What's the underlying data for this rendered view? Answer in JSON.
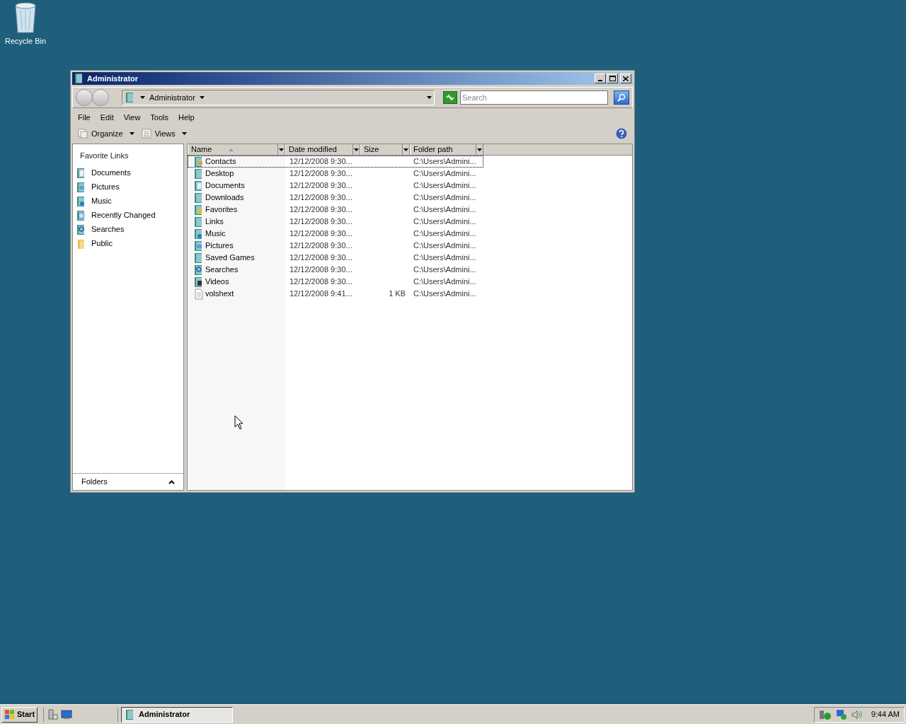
{
  "desktop_icons": [
    {
      "label": "Recycle Bin"
    }
  ],
  "window": {
    "title": "Administrator",
    "active": true
  },
  "address_bar": {
    "path": "Administrator"
  },
  "search": {
    "placeholder": "Search"
  },
  "menu_bar": [
    "File",
    "Edit",
    "View",
    "Tools",
    "Help"
  ],
  "toolbar": [
    {
      "label": "Organize",
      "kind": "organize"
    },
    {
      "label": "Views",
      "kind": "views"
    }
  ],
  "sidebar": {
    "title": "Favorite Links",
    "items": [
      {
        "label": "Documents",
        "kind": "documents"
      },
      {
        "label": "Pictures",
        "kind": "pictures"
      },
      {
        "label": "Music",
        "kind": "music"
      },
      {
        "label": "Recently Changed",
        "kind": "recent"
      },
      {
        "label": "Searches",
        "kind": "searches"
      },
      {
        "label": "Public",
        "kind": "public"
      }
    ],
    "folders_label": "Folders"
  },
  "table": {
    "columns": [
      {
        "label": "Name",
        "sorted": true
      },
      {
        "label": "Date modified",
        "sorted": false
      },
      {
        "label": "Size",
        "sorted": false
      },
      {
        "label": "Folder path",
        "sorted": false
      }
    ],
    "rows": [
      {
        "name": "Contacts",
        "kind": "contacts",
        "date": "12/12/2008 9:30...",
        "size": "",
        "path": "C:\\Users\\Admini...",
        "focused": true
      },
      {
        "name": "Desktop",
        "kind": "folder",
        "date": "12/12/2008 9:30...",
        "size": "",
        "path": "C:\\Users\\Admini...",
        "focused": false
      },
      {
        "name": "Documents",
        "kind": "documents",
        "date": "12/12/2008 9:30...",
        "size": "",
        "path": "C:\\Users\\Admini...",
        "focused": false
      },
      {
        "name": "Downloads",
        "kind": "folder",
        "date": "12/12/2008 9:30...",
        "size": "",
        "path": "C:\\Users\\Admini...",
        "focused": false
      },
      {
        "name": "Favorites",
        "kind": "favorites",
        "date": "12/12/2008 9:30...",
        "size": "",
        "path": "C:\\Users\\Admini...",
        "focused": false
      },
      {
        "name": "Links",
        "kind": "folder",
        "date": "12/12/2008 9:30...",
        "size": "",
        "path": "C:\\Users\\Admini...",
        "focused": false
      },
      {
        "name": "Music",
        "kind": "music",
        "date": "12/12/2008 9:30...",
        "size": "",
        "path": "C:\\Users\\Admini...",
        "focused": false
      },
      {
        "name": "Pictures",
        "kind": "pictures",
        "date": "12/12/2008 9:30...",
        "size": "",
        "path": "C:\\Users\\Admini...",
        "focused": false
      },
      {
        "name": "Saved Games",
        "kind": "folder",
        "date": "12/12/2008 9:30...",
        "size": "",
        "path": "C:\\Users\\Admini...",
        "focused": false
      },
      {
        "name": "Searches",
        "kind": "searches",
        "date": "12/12/2008 9:30...",
        "size": "",
        "path": "C:\\Users\\Admini...",
        "focused": false
      },
      {
        "name": "Videos",
        "kind": "videos",
        "date": "12/12/2008 9:30...",
        "size": "",
        "path": "C:\\Users\\Admini...",
        "focused": false
      },
      {
        "name": "volshext",
        "kind": "file",
        "date": "12/12/2008 9:41...",
        "size": "1 KB",
        "path": "C:\\Users\\Admini...",
        "focused": false
      }
    ]
  },
  "taskbar": {
    "start": "Start",
    "tasks": [
      {
        "label": "Administrator",
        "selected": true
      }
    ],
    "clock": "9:44 AM"
  }
}
